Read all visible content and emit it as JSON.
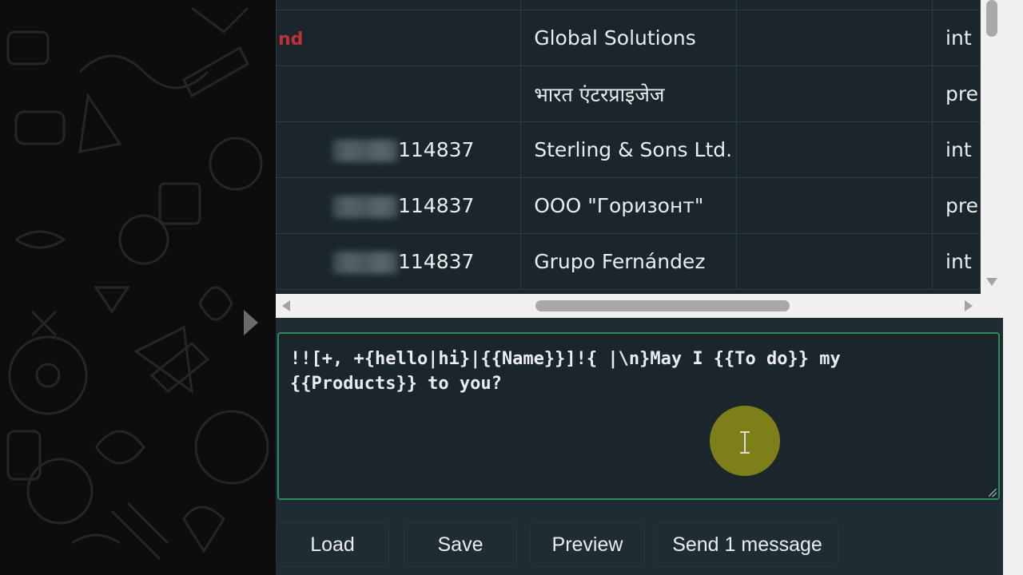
{
  "table": {
    "rows": [
      {
        "phone_fragment": "",
        "company": "",
        "tag": ""
      },
      {
        "phone_fragment": "nd",
        "company": "Global Solutions",
        "tag": "int"
      },
      {
        "phone_fragment": "",
        "company": "भारत एंटरप्राइजेज",
        "tag": "pre"
      },
      {
        "phone_fragment": "114837",
        "company": "Sterling & Sons Ltd.",
        "tag": "int"
      },
      {
        "phone_fragment": "114837",
        "company": "ООО \"Горизонт\"",
        "tag": "pre"
      },
      {
        "phone_fragment": "114837",
        "company": "Grupo Fernández",
        "tag": "int"
      }
    ]
  },
  "editor": {
    "text": "!![+, +{hello|hi}|{{Name}}]!{ |\\n}May I {{To do}} my\n{{Products}} to you?"
  },
  "buttons": {
    "load": "Load",
    "save": "Save",
    "preview": "Preview",
    "send": "Send 1 message"
  },
  "colors": {
    "panel_bg": "#1f2c33",
    "editor_border": "#2e8a5c",
    "cursor_halo": "#7d7f18",
    "error_text": "#c0303a"
  }
}
